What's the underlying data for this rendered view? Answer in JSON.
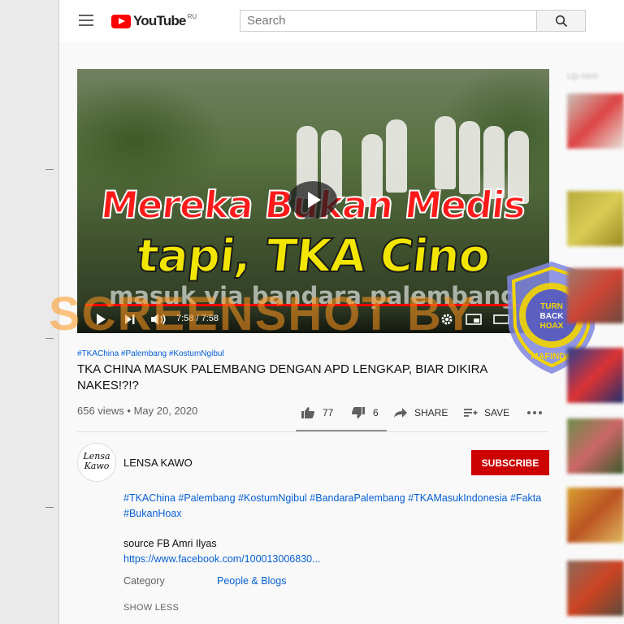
{
  "header": {
    "logo_text": "YouTube",
    "region": "RU",
    "search_placeholder": "Search"
  },
  "player": {
    "caption_line1": "Mereka Bukan Medis",
    "caption_line2": "tapi, TKA Cino",
    "caption_line3": "masuk via bandara palembang",
    "time": "7:58 / 7:58",
    "progress": 1.0
  },
  "watermark": "SCREENSHOT BY",
  "badge": {
    "ring_text": "MASYARAKAT ANTI FITNAH INDONESIA",
    "center_text": "TURN BACK HOAX",
    "bottom_text": "MAFINDO"
  },
  "video": {
    "hashtags": "#TKAChina #Palembang #KostumNgibul",
    "title": "TKA CHINA MASUK PALEMBANG DENGAN APD LENGKAP, BIAR DIKIRA NAKES!?!?",
    "views_date": "656 views • May 20, 2020",
    "likes": "77",
    "dislikes": "6",
    "share_label": "SHARE",
    "save_label": "SAVE"
  },
  "channel": {
    "name": "LENSA KAWO",
    "avatar_text": "Lensa Kawo",
    "subscribe_label": "SUBSCRIBE"
  },
  "description": {
    "hashtags": "#TKAChina #Palembang #KostumNgibul #BandaraPalembang #TKAMasukIndonesia #Fakta #BukanHoax",
    "source": "source FB Amri Ilyas",
    "link": "https://www.facebook.com/100013006830...",
    "category_label": "Category",
    "category_value": "People & Blogs",
    "show_less": "SHOW LESS"
  },
  "sidebar": {
    "up_next": "Up next"
  },
  "colors": {
    "brand_red": "#ff0000",
    "subscribe_red": "#cc0000",
    "link_blue": "#065fd4"
  }
}
